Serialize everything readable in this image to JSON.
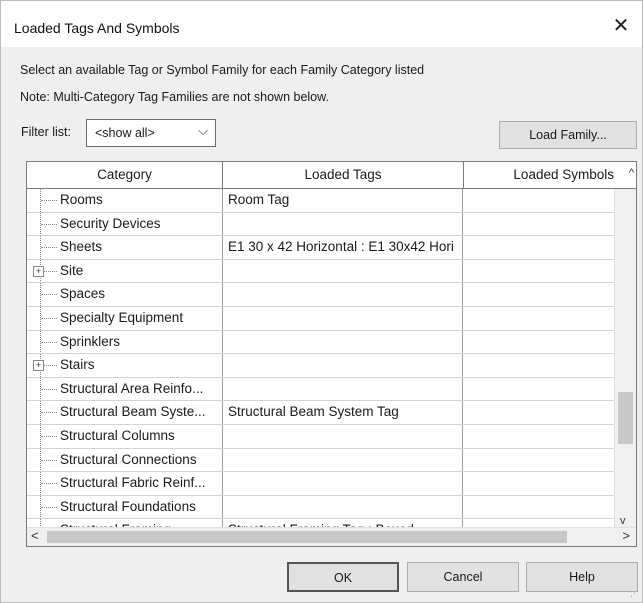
{
  "window": {
    "title": "Loaded Tags And Symbols",
    "close": "✕"
  },
  "instructions": {
    "line1": "Select an available Tag or Symbol Family for each Family Category listed",
    "line2": "Note: Multi-Category Tag Families are not shown below."
  },
  "filter": {
    "label": "Filter list:",
    "value": "<show all>"
  },
  "buttons": {
    "load_family": "Load Family...",
    "ok": "OK",
    "cancel": "Cancel",
    "help": "Help"
  },
  "table": {
    "headers": [
      "Category",
      "Loaded Tags",
      "Loaded Symbols"
    ],
    "rows": [
      {
        "category": "Rooms",
        "tags": "Room Tag",
        "symbols": "",
        "expandable": false
      },
      {
        "category": "Security Devices",
        "tags": "",
        "symbols": "",
        "expandable": false
      },
      {
        "category": "Sheets",
        "tags": "E1 30 x 42 Horizontal : E1 30x42 Hori",
        "symbols": "",
        "expandable": false
      },
      {
        "category": "Site",
        "tags": "",
        "symbols": "",
        "expandable": true
      },
      {
        "category": "Spaces",
        "tags": "",
        "symbols": "",
        "expandable": false
      },
      {
        "category": "Specialty Equipment",
        "tags": "",
        "symbols": "",
        "expandable": false
      },
      {
        "category": "Sprinklers",
        "tags": "",
        "symbols": "",
        "expandable": false
      },
      {
        "category": "Stairs",
        "tags": "",
        "symbols": "",
        "expandable": true
      },
      {
        "category": "Structural Area Reinfo...",
        "tags": "",
        "symbols": "",
        "expandable": false
      },
      {
        "category": "Structural Beam Syste...",
        "tags": "Structural Beam System Tag",
        "symbols": "",
        "expandable": false
      },
      {
        "category": "Structural Columns",
        "tags": "",
        "symbols": "",
        "expandable": false
      },
      {
        "category": "Structural Connections",
        "tags": "",
        "symbols": "",
        "expandable": false
      },
      {
        "category": "Structural Fabric Reinf...",
        "tags": "",
        "symbols": "",
        "expandable": false
      },
      {
        "category": "Structural Foundations",
        "tags": "",
        "symbols": "",
        "expandable": false
      },
      {
        "category": "Structural Framing",
        "tags": "Structural Framing Tag : Boxed",
        "symbols": "",
        "expandable": false
      }
    ]
  },
  "icons": {
    "chevron_down": "⌵",
    "scroll_up": "^",
    "scroll_down": "v",
    "scroll_left": "<",
    "scroll_right": ">",
    "expander": "+"
  }
}
